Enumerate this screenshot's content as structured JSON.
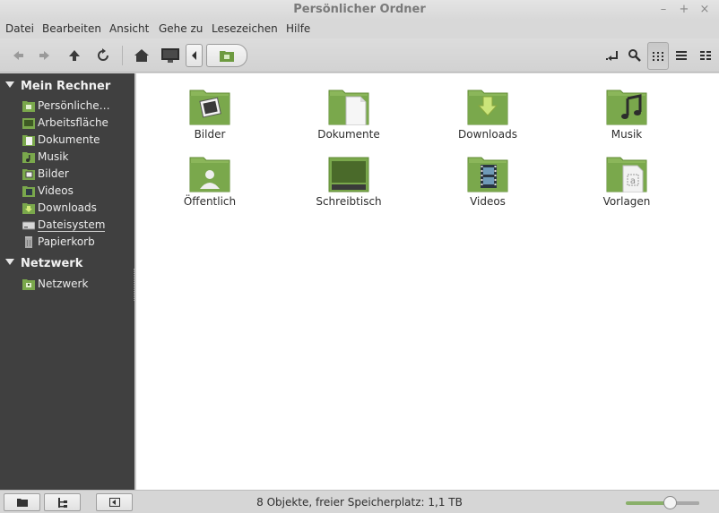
{
  "window": {
    "title": "Persönlicher Ordner",
    "min": "–",
    "max": "+",
    "close": "×"
  },
  "menu": [
    "Datei",
    "Bearbeiten",
    "Ansicht",
    "Gehe zu",
    "Lesezeichen",
    "Hilfe"
  ],
  "toolbar": {
    "back_icon": "arrow-left-icon",
    "forward_icon": "arrow-right-icon",
    "up_icon": "arrow-up-icon",
    "reload_icon": "reload-icon",
    "home_icon": "home-icon",
    "computer_icon": "monitor-icon",
    "path_toggle_icon": "chevron-left-icon",
    "current_folder_icon": "home-folder-icon"
  },
  "sidebar": {
    "sections": [
      {
        "title": "Mein Rechner",
        "items": [
          {
            "label": "Persönliche…",
            "icon": "home-folder-icon"
          },
          {
            "label": "Arbeitsfläche",
            "icon": "desktop-folder-icon"
          },
          {
            "label": "Dokumente",
            "icon": "documents-folder-icon"
          },
          {
            "label": "Musik",
            "icon": "music-folder-icon"
          },
          {
            "label": "Bilder",
            "icon": "pictures-folder-icon"
          },
          {
            "label": "Videos",
            "icon": "videos-folder-icon"
          },
          {
            "label": "Downloads",
            "icon": "downloads-folder-icon"
          },
          {
            "label": "Dateisystem",
            "icon": "drive-icon"
          },
          {
            "label": "Papierkorb",
            "icon": "trash-icon"
          }
        ]
      },
      {
        "title": "Netzwerk",
        "items": [
          {
            "label": "Netzwerk",
            "icon": "network-folder-icon"
          }
        ]
      }
    ]
  },
  "files": [
    {
      "label": "Bilder",
      "icon": "pictures-folder-icon"
    },
    {
      "label": "Dokumente",
      "icon": "documents-folder-icon"
    },
    {
      "label": "Downloads",
      "icon": "downloads-folder-icon"
    },
    {
      "label": "Musik",
      "icon": "music-folder-icon"
    },
    {
      "label": "Öffentlich",
      "icon": "public-folder-icon"
    },
    {
      "label": "Schreibtisch",
      "icon": "desktop-folder-icon"
    },
    {
      "label": "Videos",
      "icon": "videos-folder-icon"
    },
    {
      "label": "Vorlagen",
      "icon": "templates-folder-icon"
    }
  ],
  "status": {
    "text": "8 Objekte, freier Speicherplatz: 1,1 TB",
    "zoom_level": 0.6
  },
  "colors": {
    "folder_green": "#7aa84c",
    "sidebar_bg": "#404040",
    "accent": "#8ab06a"
  }
}
